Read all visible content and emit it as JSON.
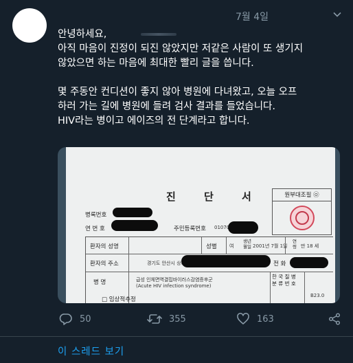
{
  "tweet": {
    "timestamp": "7월 4일",
    "lines": [
      "안녕하세요,",
      "아직 마음이 진정이 되진 않았지만 저같은 사람이 또 생기지",
      "않았으면 하는 마음에 최대한 빨리 글을 씁니다.",
      "몇 주동안 컨디션이 좋지 않아 병원에 다녀왔고, 오늘 오프",
      "하러 가는 길에 병원에 들려 검사 결과를 들었습니다.",
      "HIV라는 병이고 에이즈의 전 단계라고 합니다."
    ]
  },
  "document": {
    "title": "진 단 서",
    "preserve_label": "원부대조필 ㉧",
    "fields": {
      "record_no_label": "병록번호",
      "serial_no_label": "연 번 호",
      "resident_no_label": "주민등록번호",
      "resident_no_value": "01070",
      "patient_name_label": "환자의 성명",
      "gender_label": "성별",
      "gender_value": "여",
      "birth_label": "생년\n월일",
      "birth_value": "2001년 7월 1일",
      "age_label": "연\n령",
      "age_value": "만 18 세",
      "address_label": "환자의 주소",
      "address_value": "경기도 안산시 상록구",
      "phone_label": "전 화",
      "disease_label": "병 명",
      "diagnosis_ko": "급성 인체면역결핍바이러스감염증후군",
      "diagnosis_en": "(Acute HIV infection syndrome)",
      "clinical_label": "□ 임상적추정",
      "kcd_label": "한 국 질 병\n분 류 번 호",
      "kcd_value": "B23.0"
    }
  },
  "actions": {
    "replies": "50",
    "retweets": "355",
    "likes": "163"
  },
  "thread_link": "이 스레드 보기",
  "colors": {
    "background": "#15202b",
    "text": "#ffffff",
    "muted": "#8899a6",
    "link": "#1da1f2"
  }
}
